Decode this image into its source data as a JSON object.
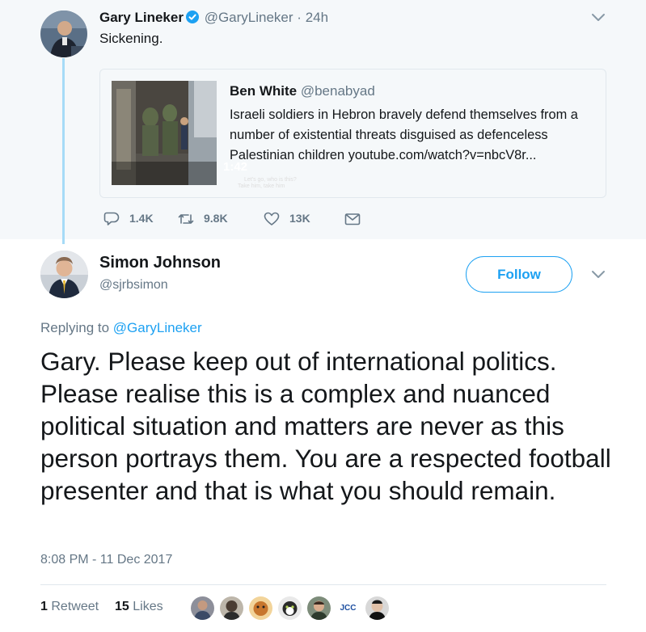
{
  "parent_tweet": {
    "name": "Gary Lineker",
    "handle": "@GaryLineker",
    "separator": "·",
    "time": "24h",
    "text": "Sickening.",
    "quoted": {
      "name": "Ben White",
      "handle": "@benabyad",
      "text": "Israeli soldiers in Hebron bravely defend themselves from a number of existential threats disguised as defenceless Palestinian children youtube.com/watch?v=nbcV8r...",
      "video_duration": "1:42",
      "subtitle_line1": "Let's go, who is this?",
      "subtitle_line2": "Take him, take him"
    },
    "actions": {
      "replies": "1.4K",
      "retweets": "9.8K",
      "likes": "13K"
    }
  },
  "main_tweet": {
    "name": "Simon Johnson",
    "handle": "@sjrbsimon",
    "follow_label": "Follow",
    "replying_prefix": "Replying to",
    "replying_to": "@GaryLineker",
    "text": "Gary. Please keep out of international politics. Please realise this is a complex and nuanced political situation and matters are never as this person portrays them. You are a respected football presenter and that is what you should remain.",
    "timestamp": "8:08 PM - 11 Dec 2017",
    "stats": {
      "retweet_count": "1",
      "retweet_label": "Retweet",
      "like_count": "15",
      "like_label": "Likes"
    },
    "liker_avatars_count": 8,
    "liker_badge_text": "JCC"
  },
  "icons": {
    "verified": "verified-badge-icon",
    "chevron": "chevron-down-icon",
    "reply": "reply-icon",
    "retweet": "retweet-icon",
    "like": "heart-icon",
    "message": "direct-message-icon"
  },
  "colors": {
    "accent": "#1da1f2",
    "secondary_text": "#657786",
    "thread_line": "#a6dbf7",
    "parent_bg": "#f5f8fa"
  }
}
